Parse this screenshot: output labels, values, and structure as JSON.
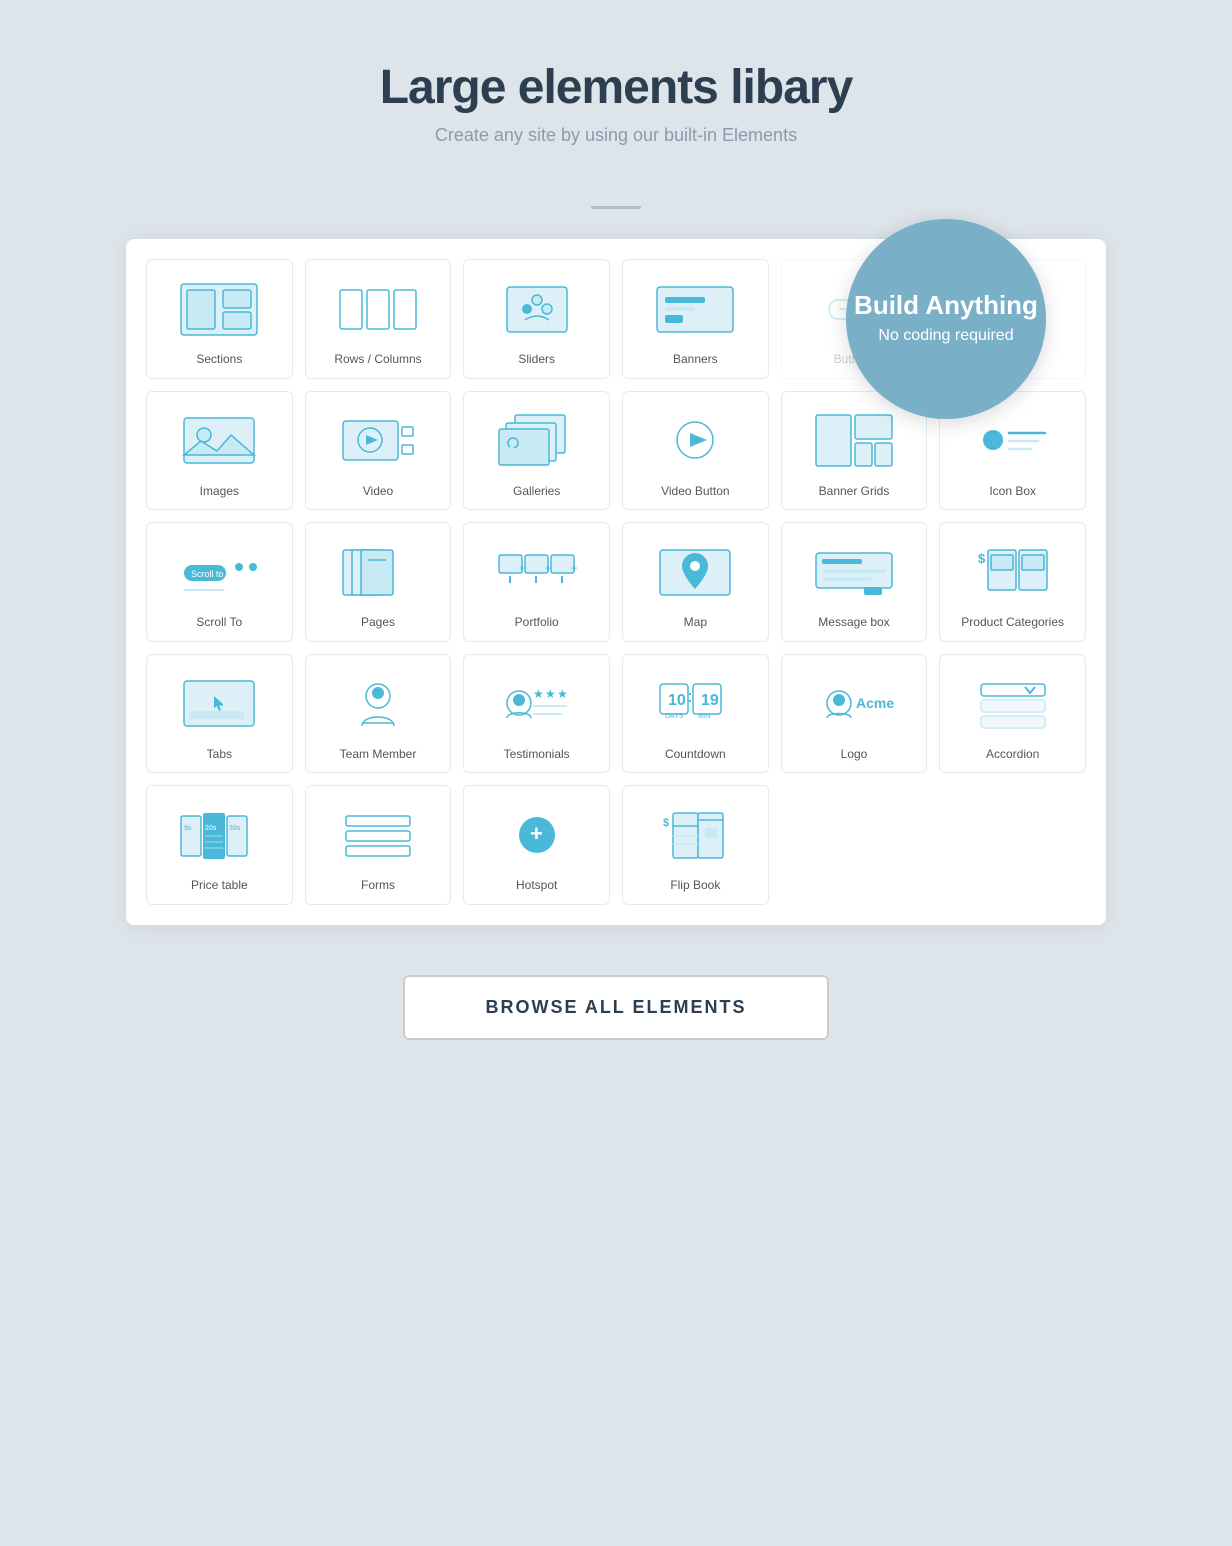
{
  "header": {
    "title": "Large elements libary",
    "subtitle": "Create any site by using our built-in Elements"
  },
  "bubble": {
    "title": "Build Anything",
    "subtitle": "No coding required"
  },
  "elements": [
    {
      "id": "sections",
      "label": "Sections"
    },
    {
      "id": "rows-columns",
      "label": "Rows / Columns"
    },
    {
      "id": "sliders",
      "label": "Sliders"
    },
    {
      "id": "banners",
      "label": "Banners"
    },
    {
      "id": "buttons",
      "label": "Buttons"
    },
    {
      "id": "icon-box-top",
      "label": ""
    },
    {
      "id": "images",
      "label": "Images"
    },
    {
      "id": "video",
      "label": "Video"
    },
    {
      "id": "galleries",
      "label": "Galleries"
    },
    {
      "id": "video-button",
      "label": "Video Button"
    },
    {
      "id": "banner-grids",
      "label": "Banner Grids"
    },
    {
      "id": "icon-box",
      "label": "Icon Box"
    },
    {
      "id": "scroll-to",
      "label": "Scroll To"
    },
    {
      "id": "pages",
      "label": "Pages"
    },
    {
      "id": "portfolio",
      "label": "Portfolio"
    },
    {
      "id": "map",
      "label": "Map"
    },
    {
      "id": "message-box",
      "label": "Message box"
    },
    {
      "id": "product-categories",
      "label": "Product Categories"
    },
    {
      "id": "tabs",
      "label": "Tabs"
    },
    {
      "id": "team-member",
      "label": "Team Member"
    },
    {
      "id": "testimonials",
      "label": "Testimonials"
    },
    {
      "id": "countdown",
      "label": "Countdown"
    },
    {
      "id": "logo",
      "label": "Logo"
    },
    {
      "id": "accordion",
      "label": "Accordion"
    },
    {
      "id": "price-table",
      "label": "Price table"
    },
    {
      "id": "forms",
      "label": "Forms"
    },
    {
      "id": "hotspot",
      "label": "Hotspot"
    },
    {
      "id": "flip-book",
      "label": "Flip Book"
    }
  ],
  "browse_button": "BROWSE ALL ELEMENTS"
}
